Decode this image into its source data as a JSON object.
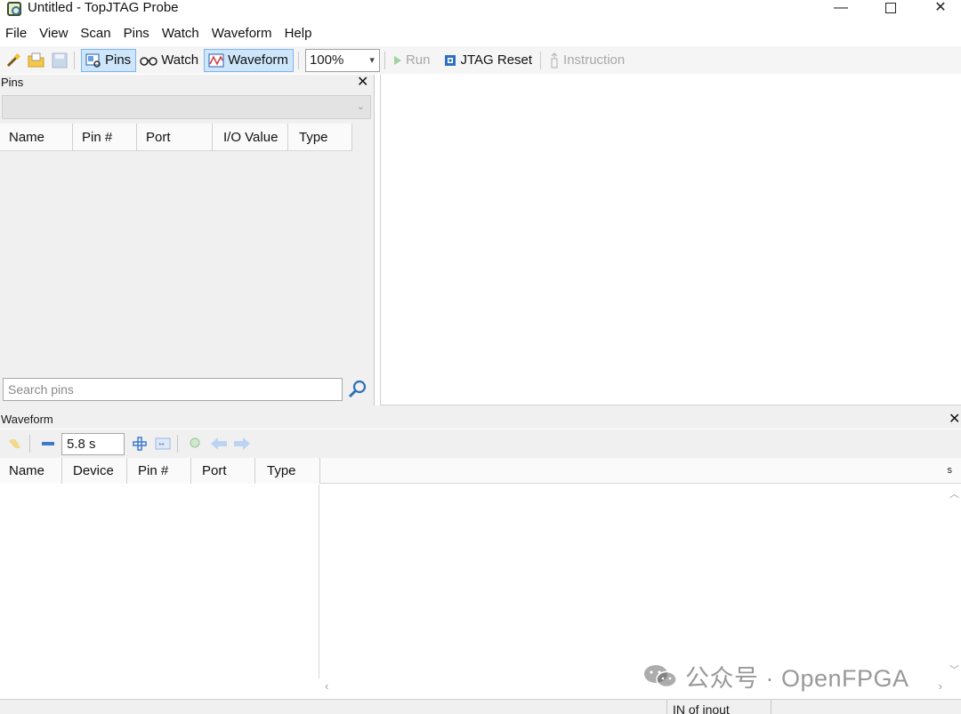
{
  "window": {
    "title": "Untitled - TopJTAG Probe",
    "minimize_glyph": "—",
    "close_glyph": "✕"
  },
  "menu": [
    "File",
    "View",
    "Scan",
    "Pins",
    "Watch",
    "Waveform",
    "Help"
  ],
  "toolbar": {
    "pins_label": "Pins",
    "watch_label": "Watch",
    "waveform_label": "Waveform",
    "zoom_value": "100%",
    "run_label": "Run",
    "jtag_reset_label": "JTAG Reset",
    "instruction_label": "Instruction",
    "icons": [
      "wand-icon",
      "open-folder-icon",
      "save-icon",
      "pins-icon",
      "glasses-icon",
      "waveform-icon",
      "play-icon",
      "reset-icon",
      "instruction-icon"
    ]
  },
  "pins_panel": {
    "title": "Pins",
    "columns": [
      "Name",
      "Pin #",
      "Port",
      "I/O Value",
      "Type"
    ],
    "rows": [],
    "search_placeholder": "Search pins"
  },
  "waveform_panel": {
    "title": "Waveform",
    "time_value": "5.8 s",
    "columns": [
      "Name",
      "Device",
      "Pin #",
      "Port",
      "Type"
    ],
    "scale_unit": "s",
    "rows": []
  },
  "status": {
    "cell_text": "IN of inout"
  },
  "watermark": {
    "text": "公众号 · OpenFPGA"
  },
  "colors": {
    "toggle_active_bg": "#cde6fb",
    "toggle_active_border": "#7eb4ea",
    "panel_bg": "#f0f0f0",
    "disabled_text": "#a8a8a8"
  }
}
